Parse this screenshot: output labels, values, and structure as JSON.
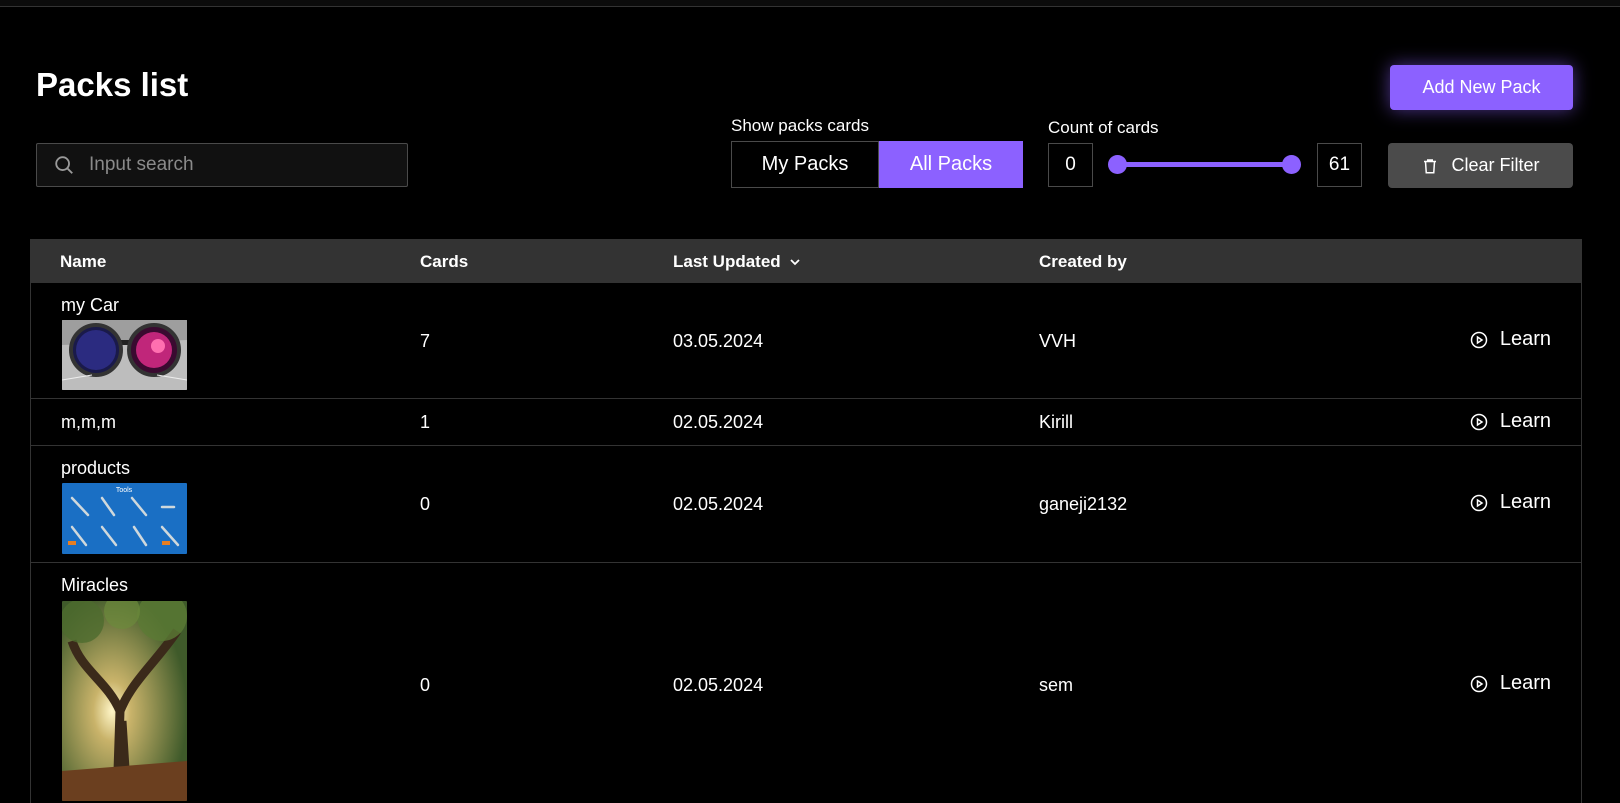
{
  "header": {
    "title": "Packs list",
    "add_button": "Add New Pack"
  },
  "search": {
    "placeholder": "Input search",
    "value": ""
  },
  "filters": {
    "show_label": "Show packs cards",
    "options": [
      "My Packs",
      "All Packs"
    ],
    "selected": "All Packs",
    "count_label": "Count of cards",
    "min": "0",
    "max": "61",
    "clear_label": "Clear Filter"
  },
  "table": {
    "columns": [
      "Name",
      "Cards",
      "Last Updated",
      "Created by"
    ],
    "sort_column": "Last Updated",
    "rows": [
      {
        "name": "my Car",
        "cards": "7",
        "updated": "03.05.2024",
        "author": "VVH",
        "action": "Learn",
        "image": "cat-sunglasses"
      },
      {
        "name": "m,m,m",
        "cards": "1",
        "updated": "02.05.2024",
        "author": "Kirill",
        "action": "Learn",
        "image": ""
      },
      {
        "name": "products",
        "cards": "0",
        "updated": "02.05.2024",
        "author": "ganeji2132",
        "action": "Learn",
        "image": "tools-chart"
      },
      {
        "name": "Miracles",
        "cards": "0",
        "updated": "02.05.2024",
        "author": "sem",
        "action": "Learn",
        "image": "forest-tree"
      }
    ],
    "tools_image_title": "Tools"
  },
  "colors": {
    "accent": "#8c61ff",
    "header_bg": "#333333",
    "background": "#000000",
    "clear_bg": "#4b4b4b"
  }
}
